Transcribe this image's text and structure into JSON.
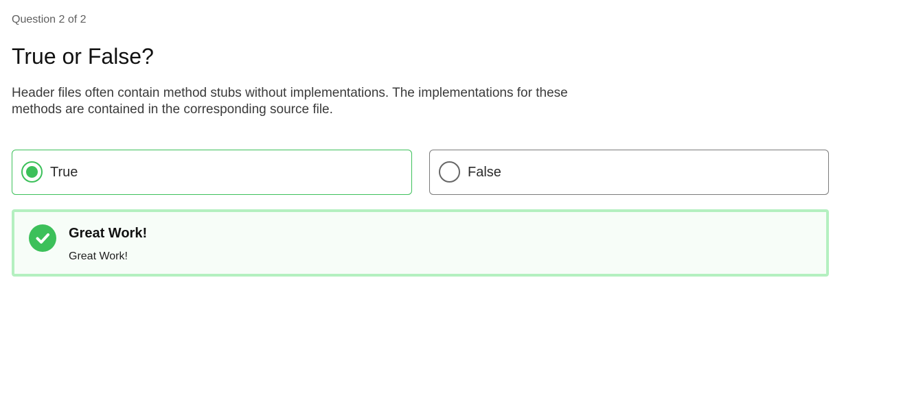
{
  "quiz": {
    "progress": "Question 2 of 2",
    "title": "True or False?",
    "prompt": "Header files often contain method stubs without implementations. The implementations for these methods are contained in the corresponding source file."
  },
  "options": [
    {
      "label": "True",
      "selected": true
    },
    {
      "label": "False",
      "selected": false
    }
  ],
  "feedback": {
    "status": "correct",
    "icon": "check-circle-icon",
    "title": "Great Work!",
    "message": "Great Work!"
  },
  "colors": {
    "accent_green": "#3cc05a",
    "feedback_border": "#b4f0c0",
    "feedback_bg": "#f7fdf8"
  }
}
